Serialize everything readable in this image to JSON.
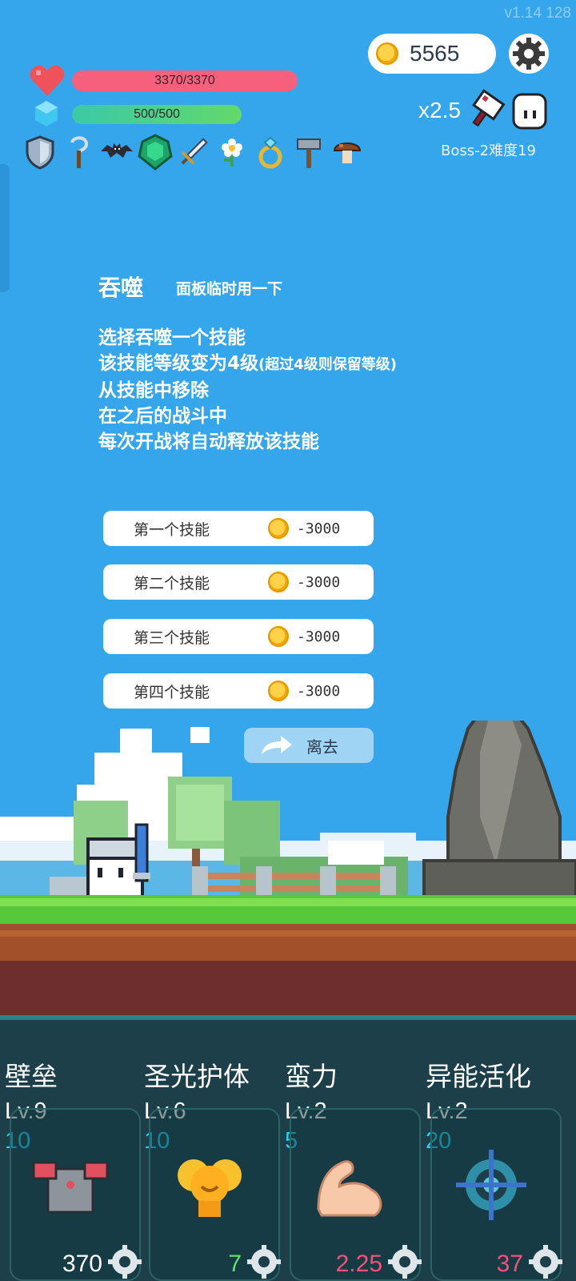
{
  "version": {
    "label": "v1.14",
    "build": "128"
  },
  "coins": "5565",
  "player": {
    "hp": "3370/3370",
    "mana": "500/500"
  },
  "multiplier": "x2.5",
  "boss_label": "Boss-2难度19",
  "items": [
    "shield-icon",
    "scythe-icon",
    "bat-icon",
    "emerald-icon",
    "sword-icon",
    "flower-icon",
    "ring-icon",
    "hammer-icon",
    "mushroom-icon"
  ],
  "panel": {
    "title": "吞噬",
    "subtitle": "面板临时用一下",
    "lines": [
      "选择吞噬一个技能",
      "该技能等级变为4级",
      "(超过4级则保留等级)",
      "从技能中移除",
      "在之后的战斗中",
      "每次开战将自动释放该技能"
    ],
    "options": [
      {
        "label": "第一个技能",
        "cost": "-3000"
      },
      {
        "label": "第二个技能",
        "cost": "-3000"
      },
      {
        "label": "第三个技能",
        "cost": "-3000"
      },
      {
        "label": "第四个技能",
        "cost": "-3000"
      }
    ],
    "leave_label": "离去"
  },
  "skills": [
    {
      "name": "壁垒",
      "level": "Lv.9",
      "count": "10",
      "value": "370",
      "value_color": "#ffffff"
    },
    {
      "name": "圣光护体",
      "level": "Lv.6",
      "count": "10",
      "value": "7",
      "value_color": "#5ee06a"
    },
    {
      "name": "蛮力",
      "level": "Lv.2",
      "count": "5",
      "value": "2.25",
      "value_color": "#f2527a"
    },
    {
      "name": "异能活化",
      "level": "Lv.2",
      "count": "20",
      "value": "37",
      "value_color": "#f2527a"
    }
  ]
}
